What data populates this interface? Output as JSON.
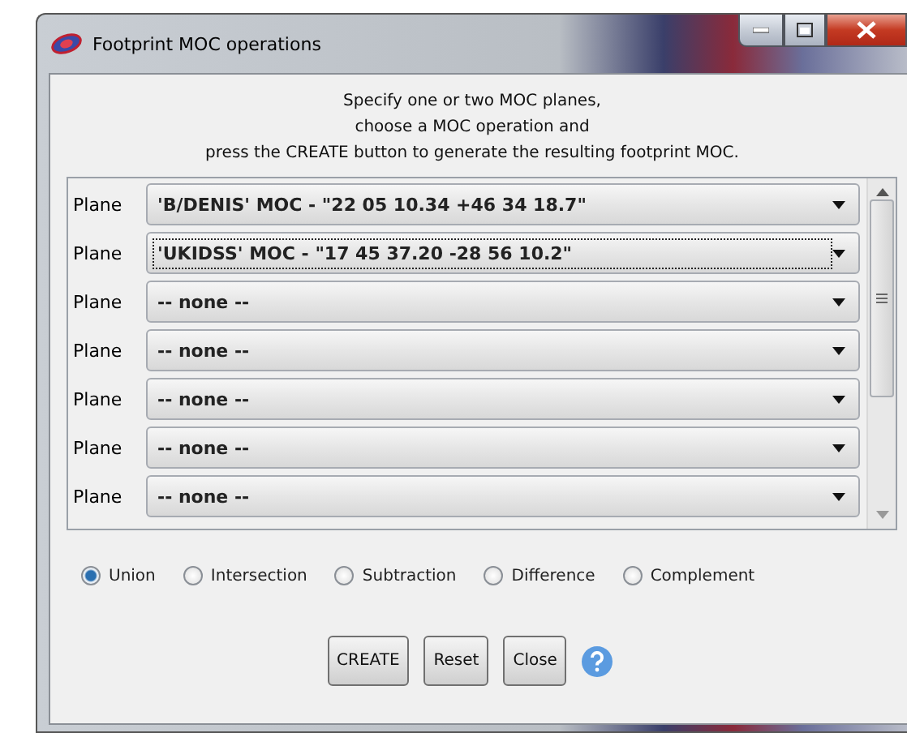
{
  "window": {
    "title": "Footprint MOC operations"
  },
  "instructions": [
    "Specify one or two MOC planes,",
    "choose a MOC operation and",
    "press the CREATE button to generate the resulting footprint MOC."
  ],
  "planes": [
    {
      "label": "Plane",
      "value": "'B/DENIS' MOC - \"22 05 10.34 +46 34 18.7\"",
      "focused": false
    },
    {
      "label": "Plane",
      "value": "'UKIDSS' MOC - \"17 45 37.20 -28 56 10.2\"",
      "focused": true
    },
    {
      "label": "Plane",
      "value": "-- none --",
      "focused": false
    },
    {
      "label": "Plane",
      "value": "-- none --",
      "focused": false
    },
    {
      "label": "Plane",
      "value": "-- none --",
      "focused": false
    },
    {
      "label": "Plane",
      "value": "-- none --",
      "focused": false
    },
    {
      "label": "Plane",
      "value": "-- none --",
      "focused": false
    }
  ],
  "operations": [
    {
      "label": "Union",
      "selected": true
    },
    {
      "label": "Intersection",
      "selected": false
    },
    {
      "label": "Subtraction",
      "selected": false
    },
    {
      "label": "Difference",
      "selected": false
    },
    {
      "label": "Complement",
      "selected": false
    }
  ],
  "buttons": [
    "CREATE",
    "Reset",
    "Close"
  ]
}
